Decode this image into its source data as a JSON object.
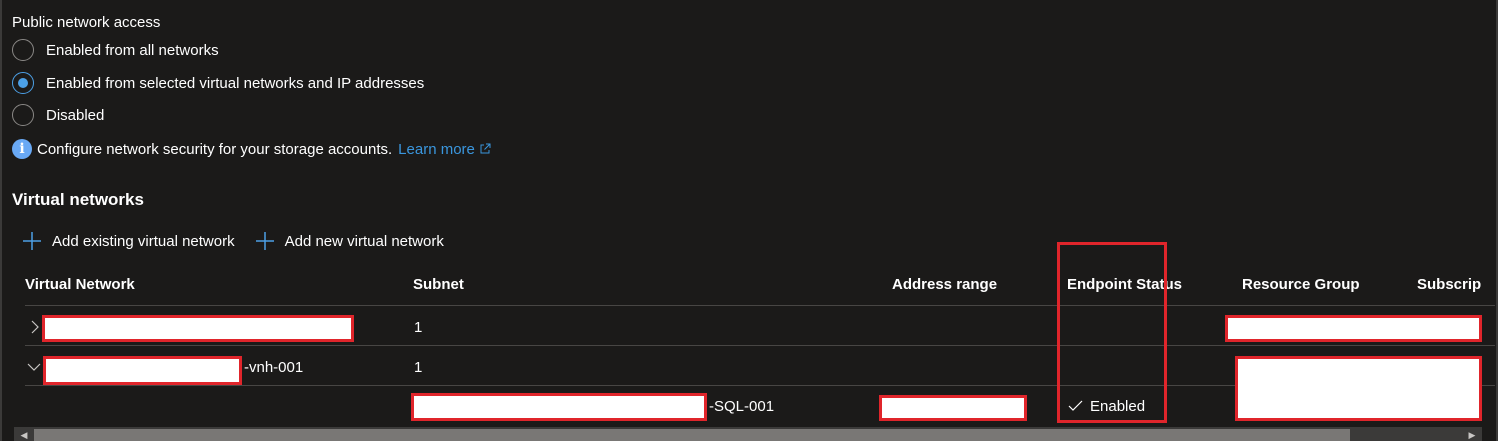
{
  "public_access": {
    "label": "Public network access",
    "options": [
      {
        "label": "Enabled from all networks",
        "checked": false
      },
      {
        "label": "Enabled from selected virtual networks and IP addresses",
        "checked": true
      },
      {
        "label": "Disabled",
        "checked": false
      }
    ]
  },
  "info": {
    "icon": "info-icon",
    "text": "Configure network security for your storage accounts.",
    "link": "Learn more"
  },
  "virtual_networks": {
    "title": "Virtual networks",
    "toolbar": {
      "add_existing": "Add existing virtual network",
      "add_new": "Add new virtual network"
    },
    "columns": [
      "Virtual Network",
      "Subnet",
      "Address range",
      "Endpoint Status",
      "Resource Group",
      "Subscrip"
    ],
    "rows": [
      {
        "expanded": false,
        "network_suffix": "",
        "subnet": "1"
      },
      {
        "expanded": true,
        "network_suffix": "-vnh-001",
        "subnet": "1"
      },
      {
        "subnet_suffix": "-SQL-001",
        "endpoint_status": "Enabled"
      }
    ]
  },
  "colors": {
    "background": "#1b1a19",
    "accent": "#4ca0e6",
    "link": "#3a96dd",
    "redaction_border": "#e0252b"
  }
}
